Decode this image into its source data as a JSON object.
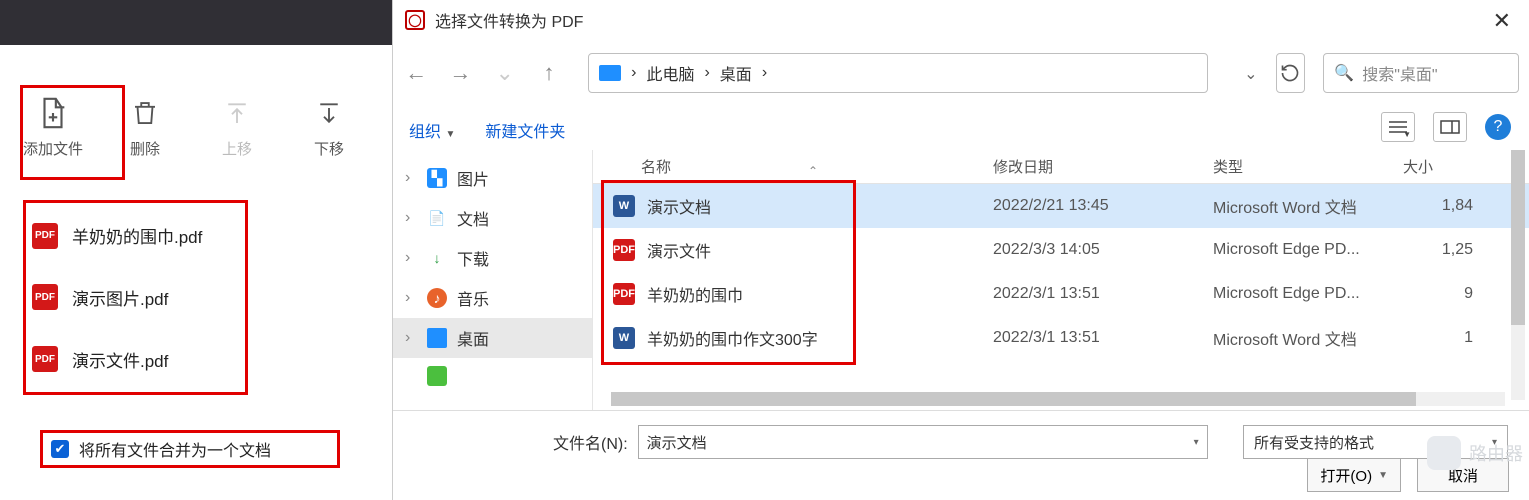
{
  "app": {
    "toolbar": {
      "add": {
        "label": "添加文件"
      },
      "delete": {
        "label": "删除"
      },
      "moveup": {
        "label": "上移"
      },
      "movedown": {
        "label": "下移"
      }
    },
    "files": [
      {
        "name": "羊奶奶的围巾.pdf"
      },
      {
        "name": "演示图片.pdf"
      },
      {
        "name": "演示文件.pdf"
      }
    ],
    "merge_label": "将所有文件合并为一个文档"
  },
  "dialog": {
    "title": "选择文件转换为 PDF",
    "breadcrumbs": {
      "root": "此电脑",
      "sep": "›",
      "leaf": "桌面"
    },
    "search_placeholder": "搜索\"桌面\"",
    "organize": "组织",
    "newfolder": "新建文件夹",
    "tree": [
      {
        "label": "图片",
        "icon": "🖼️",
        "color": "#1f8fff"
      },
      {
        "label": "文档",
        "icon": "📄",
        "color": "#4a7bd1"
      },
      {
        "label": "下载",
        "icon": "↓",
        "color": "#2e9e44"
      },
      {
        "label": "音乐",
        "icon": "♪",
        "color": "#e8632b"
      },
      {
        "label": "桌面",
        "icon": "▬",
        "color": "#1f8fff",
        "selected": true
      },
      {
        "label": "",
        "icon": "◼",
        "color": "#4bbf3e"
      }
    ],
    "columns": {
      "name": "名称",
      "date": "修改日期",
      "type": "类型",
      "size": "大小"
    },
    "rows": [
      {
        "name": "演示文档",
        "date": "2022/2/21 13:45",
        "type": "Microsoft Word 文档",
        "size": "1,84",
        "kind": "word",
        "selected": true
      },
      {
        "name": "演示文件",
        "date": "2022/3/3 14:05",
        "type": "Microsoft Edge PD...",
        "size": "1,25",
        "kind": "pdf"
      },
      {
        "name": "羊奶奶的围巾",
        "date": "2022/3/1 13:51",
        "type": "Microsoft Edge PD...",
        "size": "9",
        "kind": "pdf"
      },
      {
        "name": "羊奶奶的围巾作文300字",
        "date": "2022/3/1 13:51",
        "type": "Microsoft Word 文档",
        "size": "1",
        "kind": "word"
      }
    ],
    "filename_label": "文件名(N):",
    "filename_value": "演示文档",
    "filetype_value": "所有受支持的格式",
    "open_label": "打开(O)",
    "cancel_label": "取消"
  },
  "watermark": "路由器"
}
